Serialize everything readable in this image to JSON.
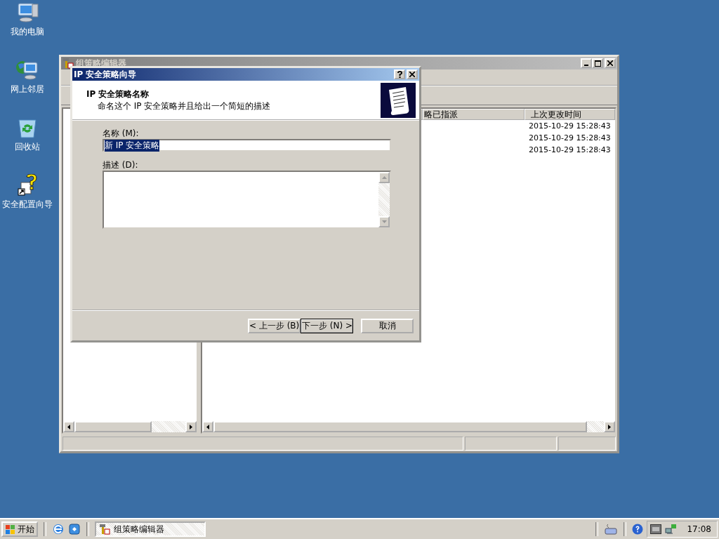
{
  "desktop_icons": [
    {
      "label": "我的电脑",
      "kind": "computer"
    },
    {
      "label": "网上邻居",
      "kind": "network"
    },
    {
      "label": "回收站",
      "kind": "recycle"
    },
    {
      "label": "安全配置向导",
      "kind": "wizard"
    }
  ],
  "main_window": {
    "title": "组策略编辑器",
    "active": false,
    "list": {
      "columns": [
        "略已指派",
        "上次更改时间"
      ],
      "rows": [
        {
          "time": "2015-10-29 15:28:43"
        },
        {
          "time": "2015-10-29 15:28:43"
        },
        {
          "time": "2015-10-29 15:28:43"
        }
      ]
    }
  },
  "dialog": {
    "title": "IP 安全策略向导",
    "active": true,
    "header": {
      "title": "IP 安全策略名称",
      "subtitle": "命名这个 IP 安全策略并且给出一个简短的描述"
    },
    "name_field": {
      "label": "名称 (M):",
      "value": "新 IP 安全策略",
      "selected": true
    },
    "description_field": {
      "label": "描述 (D):"
    },
    "buttons": [
      {
        "label": "< 上一步 (B)",
        "default": false
      },
      {
        "label": "下一步 (N) >",
        "default": true
      },
      {
        "label": "取消",
        "default": false
      }
    ]
  },
  "taskbar": {
    "start": "开始",
    "tasks": [
      {
        "label": "组策略编辑器",
        "selected": true
      }
    ],
    "clock": "17:08"
  }
}
